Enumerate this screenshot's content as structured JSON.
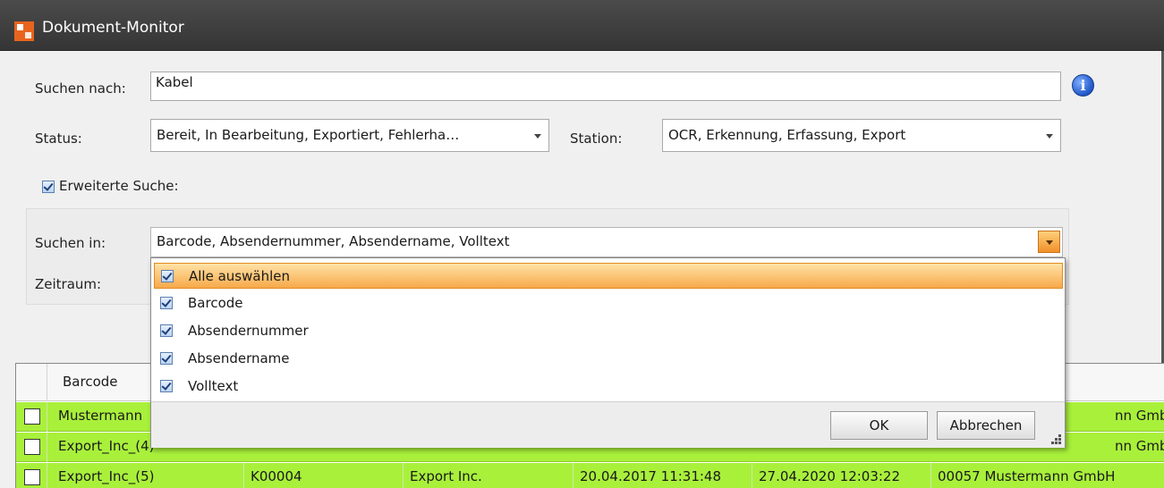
{
  "window": {
    "title": "Dokument-Monitor"
  },
  "search": {
    "label": "Suchen nach:",
    "value": "Kabel"
  },
  "status": {
    "label": "Status:",
    "value": "Bereit, In Bearbeitung, Exportiert, Fehlerha…"
  },
  "station": {
    "label": "Station:",
    "value": "OCR, Erkennung, Erfassung, Export"
  },
  "extended": {
    "label": "Erweiterte Suche:",
    "checked": true
  },
  "search_in": {
    "label": "Suchen in:",
    "value": "Barcode, Absendernummer, Absendername, Volltext"
  },
  "timerange": {
    "label": "Zeitraum:"
  },
  "dropdown": {
    "items": [
      {
        "label": "Alle auswählen",
        "checked": true,
        "highlighted": true
      },
      {
        "label": "Barcode",
        "checked": true
      },
      {
        "label": "Absendernummer",
        "checked": true
      },
      {
        "label": "Absendername",
        "checked": true
      },
      {
        "label": "Volltext",
        "checked": true
      }
    ],
    "ok_label": "OK",
    "cancel_label": "Abbrechen"
  },
  "grid": {
    "header_barcode": "Barcode",
    "rows": [
      {
        "barcode": "Mustermann",
        "sender": "nn GmbH"
      },
      {
        "barcode": "Export_Inc_(4)",
        "sender": "nn GmbH"
      },
      {
        "barcode": "Export_Inc_(5)",
        "number": "K00004",
        "name": "Export Inc.",
        "created": "20.04.2017 11:31:48",
        "modified": "27.04.2020 12:03:22",
        "sender": "00057 Mustermann GmbH"
      }
    ]
  },
  "colors": {
    "titlebar": "#3d3d3d",
    "row_green": "#a9f03b",
    "highlight": "#f7a94a"
  }
}
